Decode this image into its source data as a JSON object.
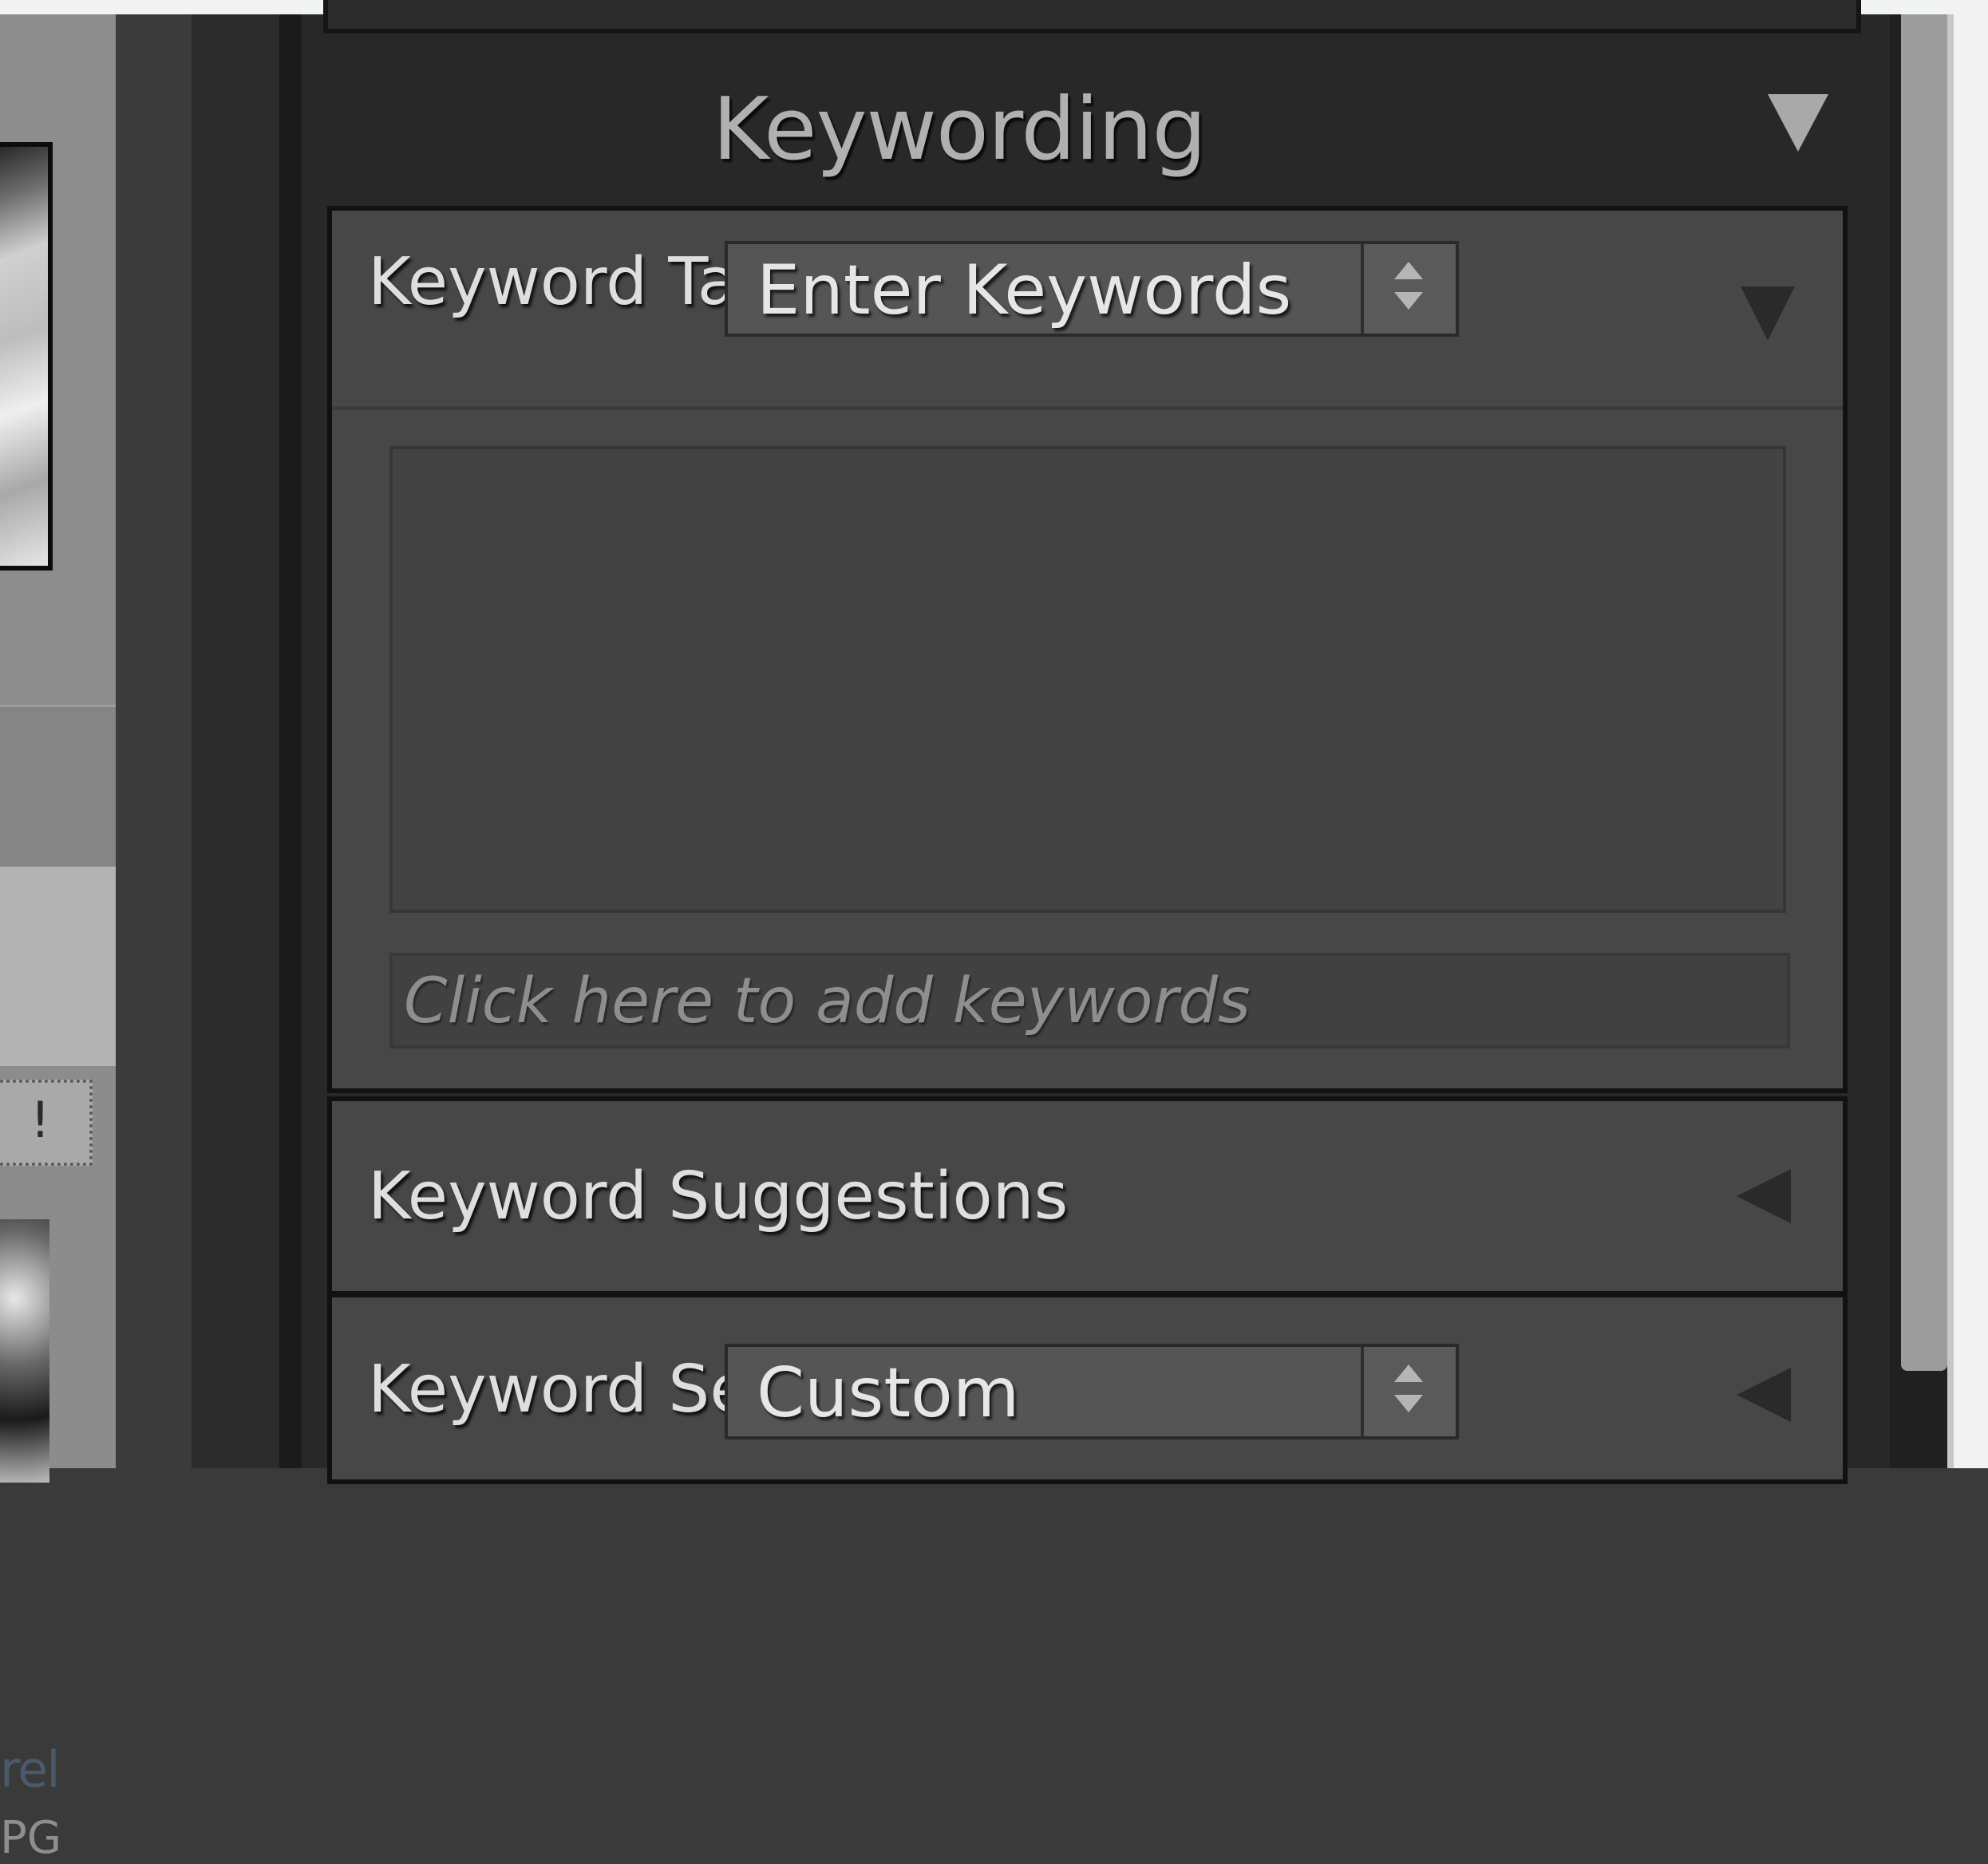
{
  "filmstrip": {
    "file_name": "rel",
    "file_ext": "PG",
    "badge": "!"
  },
  "panel": {
    "title": "Keywording"
  },
  "keyword_tags": {
    "label": "Keyword Tags",
    "dropdown_value": "Enter Keywords",
    "add_placeholder": "Click here to add keywords"
  },
  "keyword_suggestions": {
    "label": "Keyword Suggestions"
  },
  "keyword_set": {
    "label": "Keyword Set",
    "dropdown_value": "Custom"
  },
  "colors": {
    "panel_bg": "#282828",
    "section_bg": "#474747",
    "text": "#dedede"
  },
  "icons": {
    "panel_toggle": "triangle-down-icon",
    "section_expanded": "triangle-down-icon",
    "section_collapsed": "triangle-left-icon",
    "stepper": "up-down-stepper-icon"
  }
}
